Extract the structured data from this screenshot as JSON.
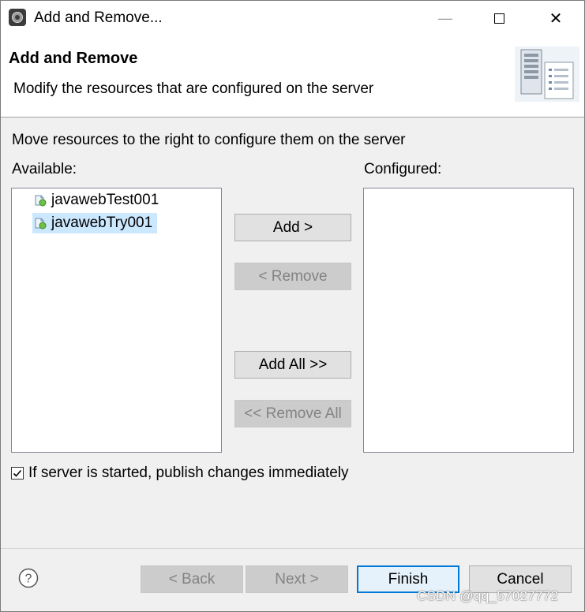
{
  "window": {
    "title": "Add and Remove...",
    "controls": {
      "minimize": "—",
      "close": "✕"
    }
  },
  "header": {
    "title": "Add and Remove",
    "description": "Modify the resources that are configured on the server"
  },
  "instructions": "Move resources to the right to configure them on the server",
  "available": {
    "label": "Available:",
    "items": [
      {
        "label": "javawebTest001",
        "selected": false
      },
      {
        "label": "javawebTry001",
        "selected": true
      }
    ]
  },
  "configured": {
    "label": "Configured:",
    "items": []
  },
  "actions": {
    "add": "Add >",
    "remove": "< Remove",
    "add_all": "Add All >>",
    "remove_all": "<< Remove All"
  },
  "publish_option": {
    "label": "If server is started, publish changes immediately",
    "checked": true
  },
  "footer": {
    "back": "< Back",
    "next": "Next >",
    "finish": "Finish",
    "cancel": "Cancel"
  },
  "watermark": "CSDN @qq_57027772",
  "icons": {
    "app": "eclipse-gear-icon",
    "header": "server-icon",
    "project": "web-project-icon",
    "help": "help-icon"
  },
  "colors": {
    "selection": "#cce8ff",
    "default_button_border": "#0078d7",
    "dialog_background": "#f0f0f0"
  }
}
